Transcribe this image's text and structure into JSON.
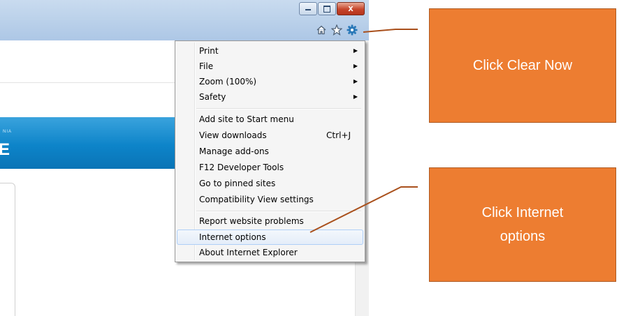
{
  "window": {
    "minimize_icon": "minimize-icon",
    "restore_icon": "restore-icon",
    "close_glyph": "x"
  },
  "toolbar": {
    "icons": [
      "home-icon",
      "star-icon",
      "gear-icon"
    ]
  },
  "page": {
    "banner_small": "NIA",
    "banner_big": "E"
  },
  "menu": {
    "items": [
      {
        "label": "Print",
        "submenu": true
      },
      {
        "label": "File",
        "submenu": true
      },
      {
        "label": "Zoom (100%)",
        "submenu": true
      },
      {
        "label": "Safety",
        "submenu": true
      },
      {
        "label": "Add site to Start menu"
      },
      {
        "label": "View downloads",
        "shortcut": "Ctrl+J"
      },
      {
        "label": "Manage add-ons"
      },
      {
        "label": "F12 Developer Tools"
      },
      {
        "label": "Go to pinned sites"
      },
      {
        "label": "Compatibility View settings"
      },
      {
        "label": "Report website problems"
      },
      {
        "label": "Internet options",
        "highlighted": true
      },
      {
        "label": "About Internet Explorer"
      }
    ],
    "arrow_glyph": "▶"
  },
  "callouts": {
    "first": "Click Clear Now",
    "second_line1": "Click Internet",
    "second_line2": "options"
  },
  "colors": {
    "callout_fill": "#ed7d31",
    "callout_text": "#ffffff",
    "connector": "#a9501c",
    "menu_highlight": "#e4edf9"
  }
}
